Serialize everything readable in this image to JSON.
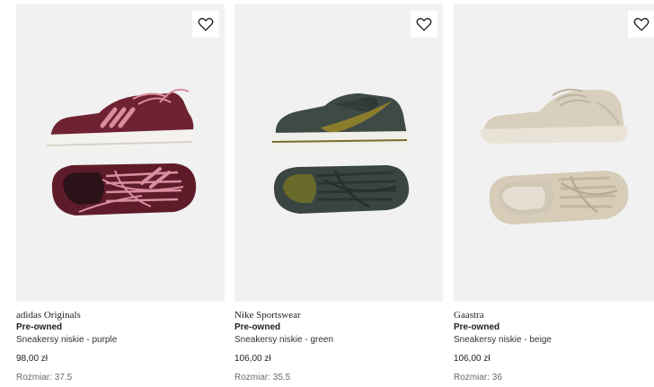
{
  "products": [
    {
      "brand": "adidas Originals",
      "condition": "Pre-owned",
      "title": "Sneakersy niskie - purple",
      "price": "98,00 zł",
      "size": "Rozmiar: 37.5",
      "colors": {
        "upper": "#6e2232",
        "stripes": "#d98ea0",
        "sole": "#f4f2ee",
        "insole": "#3a1820"
      }
    },
    {
      "brand": "Nike Sportswear",
      "condition": "Pre-owned",
      "title": "Sneakersy niskie - green",
      "price": "106,00 zł",
      "size": "Rozmiar: 35.5",
      "colors": {
        "upper": "#3e4a46",
        "swoosh": "#8a7d2c",
        "sole": "#f0efe9",
        "insole": "#2b3431"
      }
    },
    {
      "brand": "Gaastra",
      "condition": "Pre-owned",
      "title": "Sneakersy niskie - beige",
      "price": "106,00 zł",
      "size": "Rozmiar: 36",
      "colors": {
        "upper": "#d9cfbd",
        "sole": "#e9e3d7",
        "insole": "#cfc6b4"
      }
    }
  ],
  "icons": {
    "favorite": "heart-outline-icon"
  }
}
